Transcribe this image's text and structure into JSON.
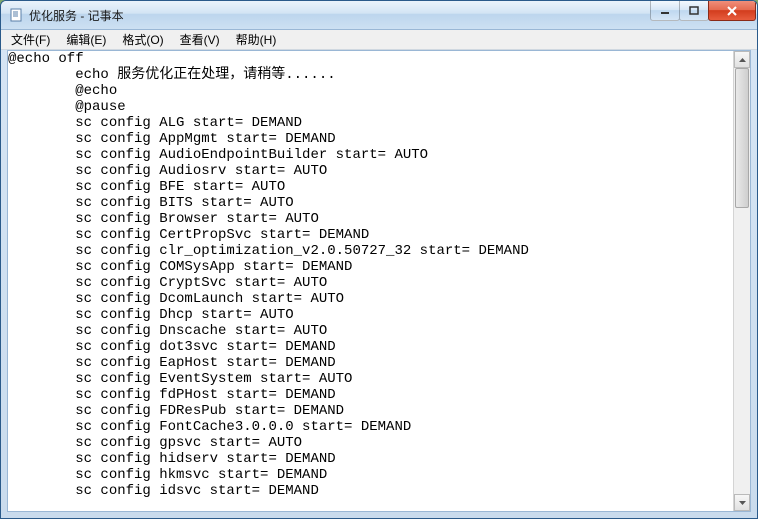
{
  "window": {
    "title": "优化服务 - 记事本"
  },
  "menubar": {
    "items": [
      {
        "label": "文件(F)"
      },
      {
        "label": "编辑(E)"
      },
      {
        "label": "格式(O)"
      },
      {
        "label": "查看(V)"
      },
      {
        "label": "帮助(H)"
      }
    ]
  },
  "editor": {
    "content": "@echo off\n        echo 服务优化正在处理，请稍等......\n        @echo\n        @pause\n        sc config ALG start= DEMAND\n        sc config AppMgmt start= DEMAND\n        sc config AudioEndpointBuilder start= AUTO\n        sc config Audiosrv start= AUTO\n        sc config BFE start= AUTO\n        sc config BITS start= AUTO\n        sc config Browser start= AUTO\n        sc config CertPropSvc start= DEMAND\n        sc config clr_optimization_v2.0.50727_32 start= DEMAND\n        sc config COMSysApp start= DEMAND\n        sc config CryptSvc start= AUTO\n        sc config DcomLaunch start= AUTO\n        sc config Dhcp start= AUTO\n        sc config Dnscache start= AUTO\n        sc config dot3svc start= DEMAND\n        sc config EapHost start= DEMAND\n        sc config EventSystem start= AUTO\n        sc config fdPHost start= DEMAND\n        sc config FDResPub start= DEMAND\n        sc config FontCache3.0.0.0 start= DEMAND\n        sc config gpsvc start= AUTO\n        sc config hidserv start= DEMAND\n        sc config hkmsvc start= DEMAND\n        sc config idsvc start= DEMAND"
  }
}
